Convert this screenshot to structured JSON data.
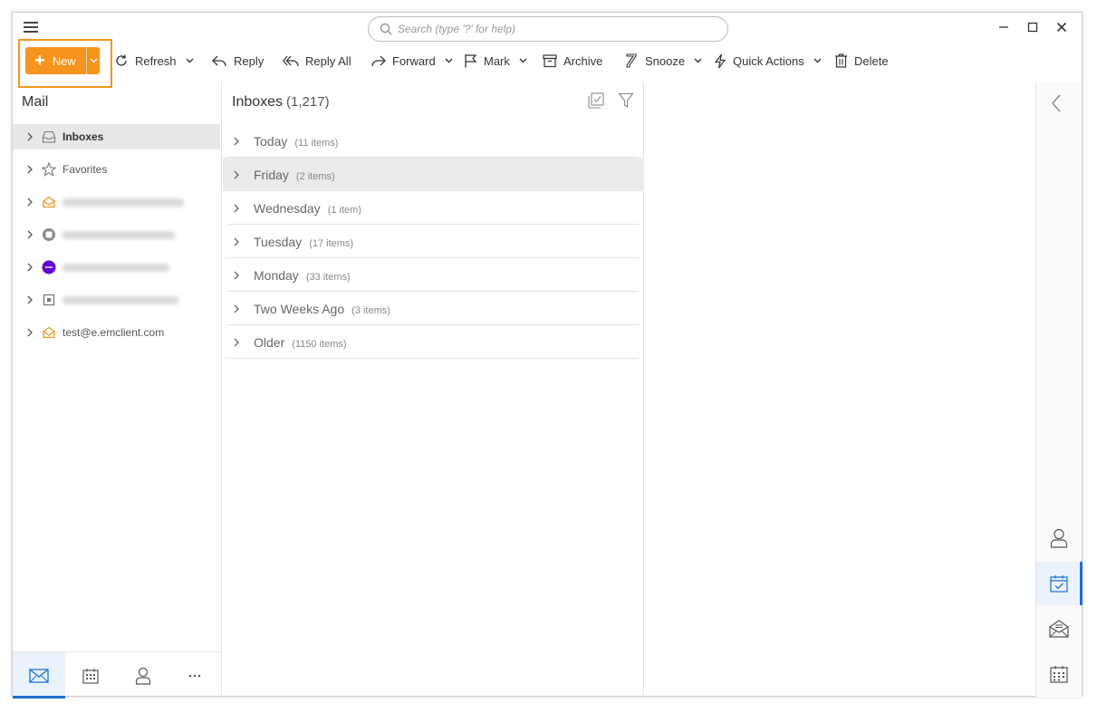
{
  "search": {
    "placeholder": "Search (type '?' for help)"
  },
  "toolbar": {
    "new_label": "New",
    "refresh_label": "Refresh",
    "reply_label": "Reply",
    "reply_all_label": "Reply All",
    "forward_label": "Forward",
    "mark_label": "Mark",
    "archive_label": "Archive",
    "snooze_label": "Snooze",
    "quick_actions_label": "Quick Actions",
    "delete_label": "Delete"
  },
  "sidebar": {
    "title": "Mail",
    "items": [
      {
        "label": "Inboxes",
        "icon": "inbox-icon",
        "selected": true
      },
      {
        "label": "Favorites",
        "icon": "star-icon",
        "selected": false
      },
      {
        "label": "",
        "icon": "mail-account-icon",
        "blurred": true
      },
      {
        "label": "",
        "icon": "gray-account-icon",
        "blurred": true
      },
      {
        "label": "",
        "icon": "yahoo-account-icon",
        "blurred": true
      },
      {
        "label": "",
        "icon": "square-account-icon",
        "blurred": true
      },
      {
        "label": "test@e.emclient.com",
        "icon": "mail-account-icon",
        "selected": false
      }
    ]
  },
  "bottom_nav": [
    {
      "name": "mail-icon",
      "active": true
    },
    {
      "name": "calendar-icon",
      "active": false
    },
    {
      "name": "contacts-icon",
      "active": false
    },
    {
      "name": "more-icon",
      "active": false
    }
  ],
  "list": {
    "title": "Inboxes",
    "count": "(1,217)",
    "groups": [
      {
        "name": "Today",
        "count": "(11 items)"
      },
      {
        "name": "Friday",
        "count": "(2 items)"
      },
      {
        "name": "Wednesday",
        "count": "(1 item)"
      },
      {
        "name": "Tuesday",
        "count": "(17 items)"
      },
      {
        "name": "Monday",
        "count": "(33 items)"
      },
      {
        "name": "Two Weeks Ago",
        "count": "(3 items)"
      },
      {
        "name": "Older",
        "count": "(1150 items)"
      }
    ]
  },
  "colors": {
    "accent": "#f7941d",
    "highlight_border": "#f0961e",
    "active_blue": "#1e6fd0"
  }
}
